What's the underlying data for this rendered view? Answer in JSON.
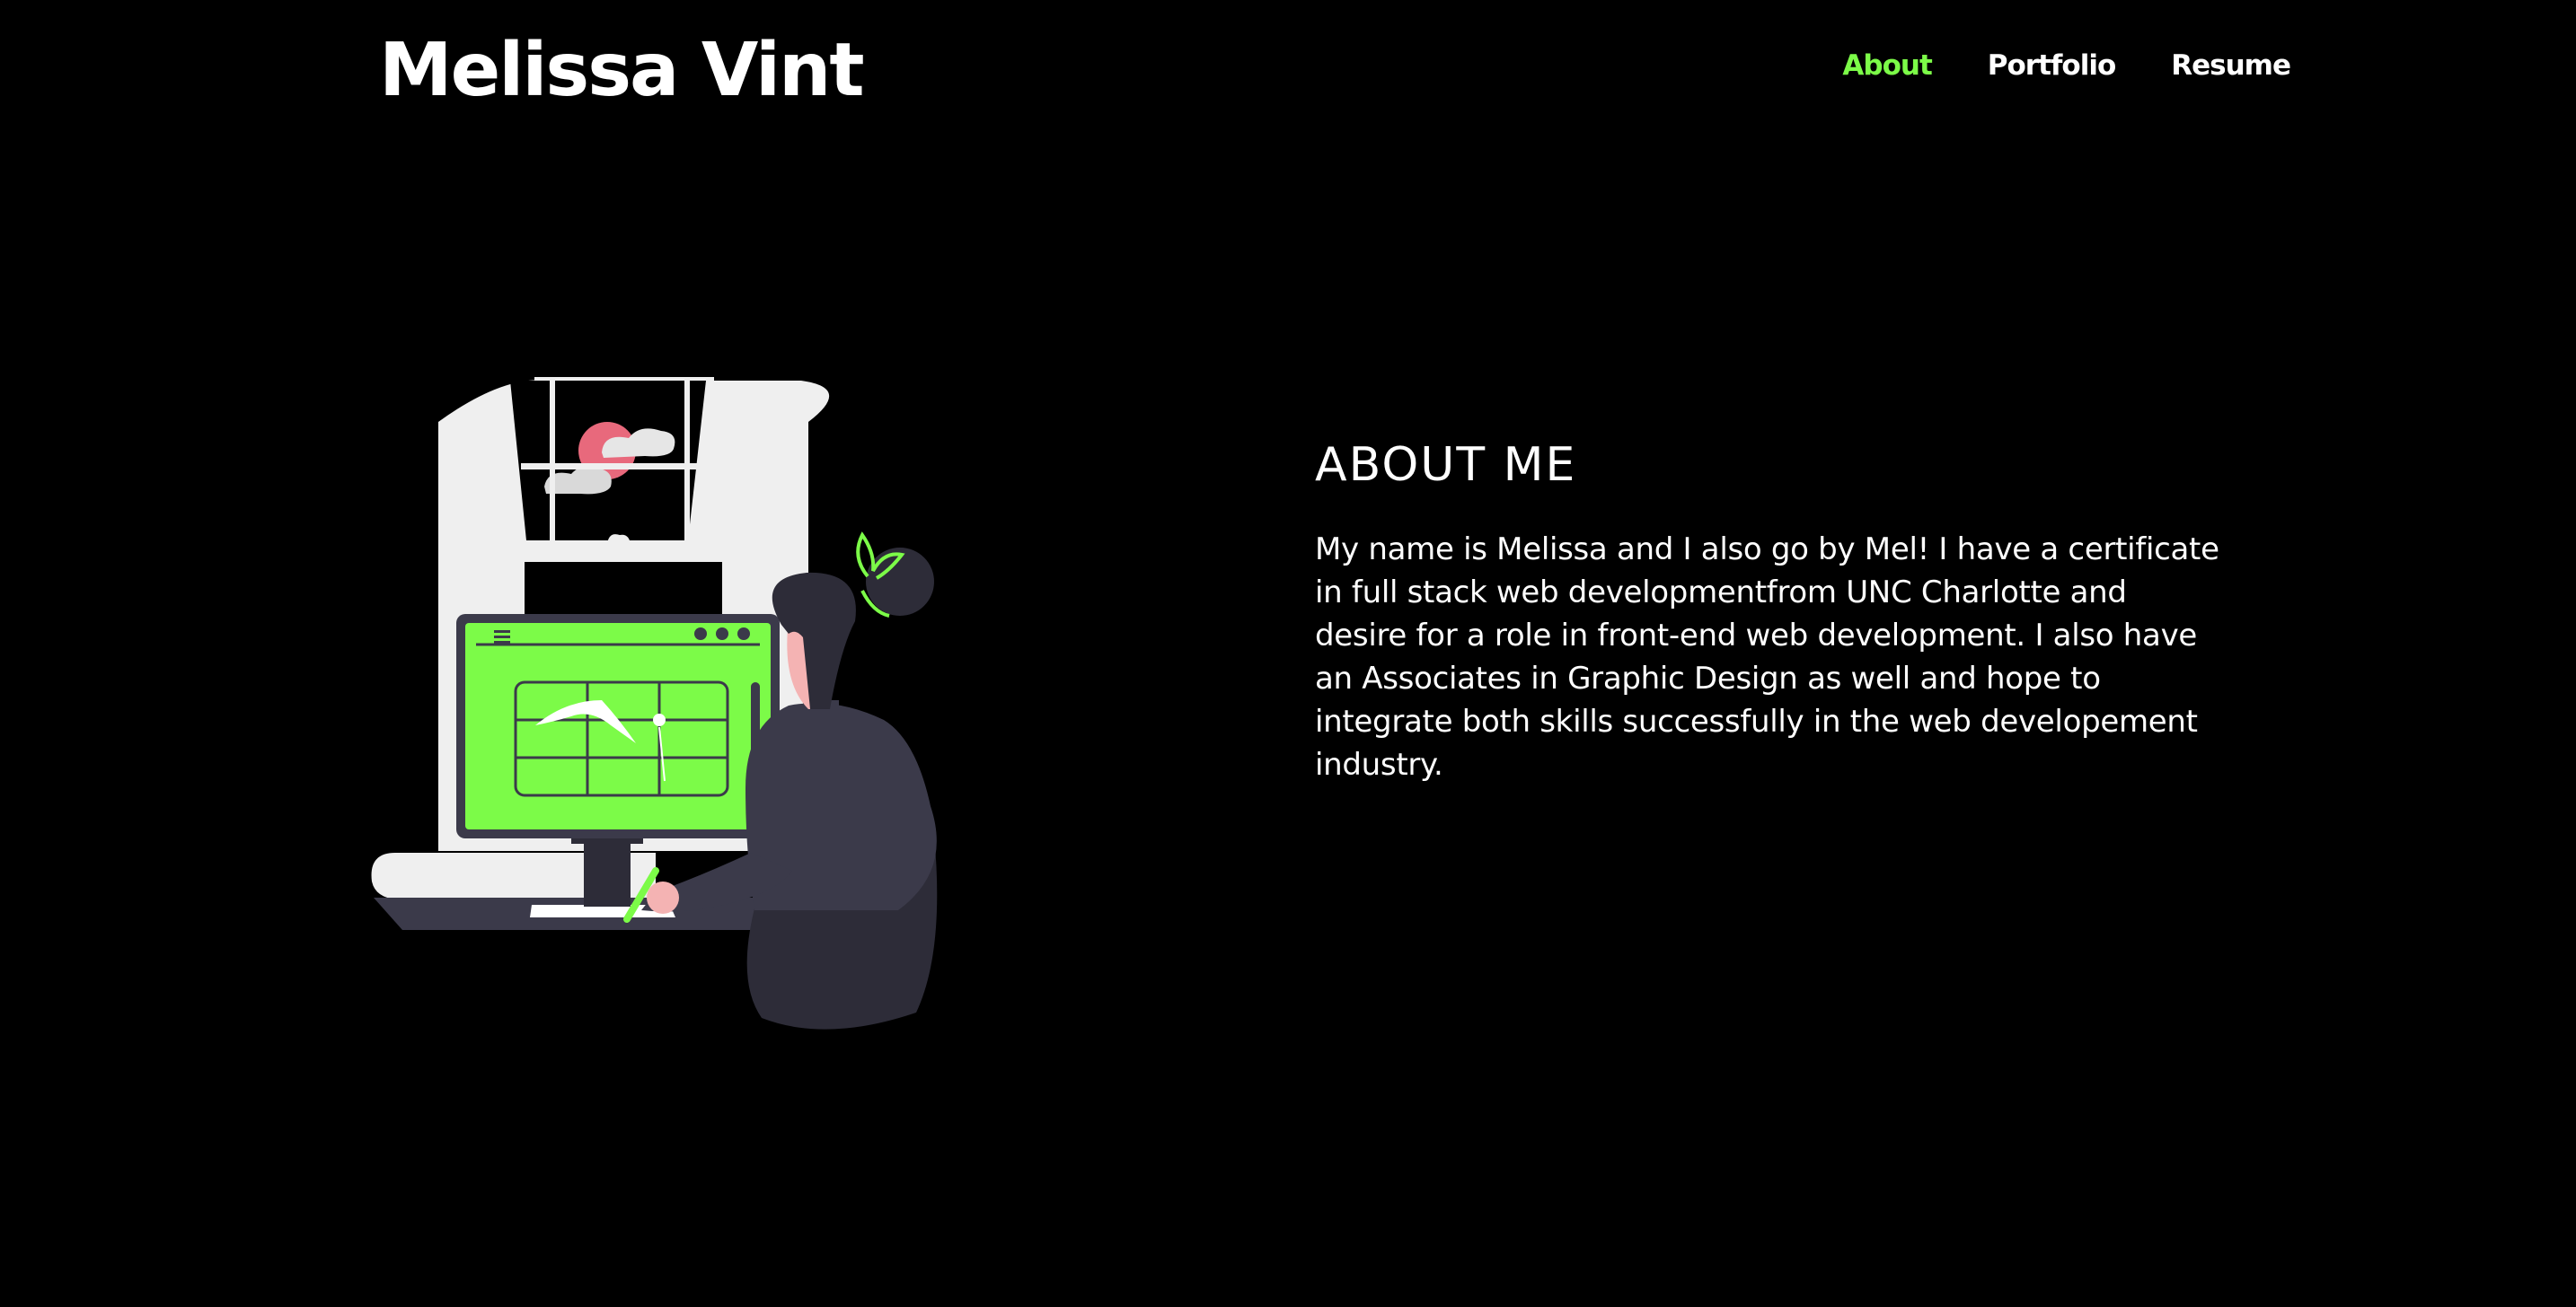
{
  "header": {
    "title": "Melissa Vint",
    "nav": [
      {
        "label": "About",
        "active": true
      },
      {
        "label": "Portfolio",
        "active": false
      },
      {
        "label": "Resume",
        "active": false
      }
    ]
  },
  "about": {
    "heading": "ABOUT ME",
    "body": "My name is Melissa and I also go by Mel! I have a certificate in full stack web developmentfrom UNC Charlotte and desire for a role in front-end web development. I also have an Associates in Graphic Design as well and hope to integrate both skills successfully in the web developement industry."
  },
  "colors": {
    "background": "#000000",
    "accent": "#7cfb48",
    "text": "#ffffff"
  },
  "icons": [
    "designer-at-monitor-illustration"
  ]
}
